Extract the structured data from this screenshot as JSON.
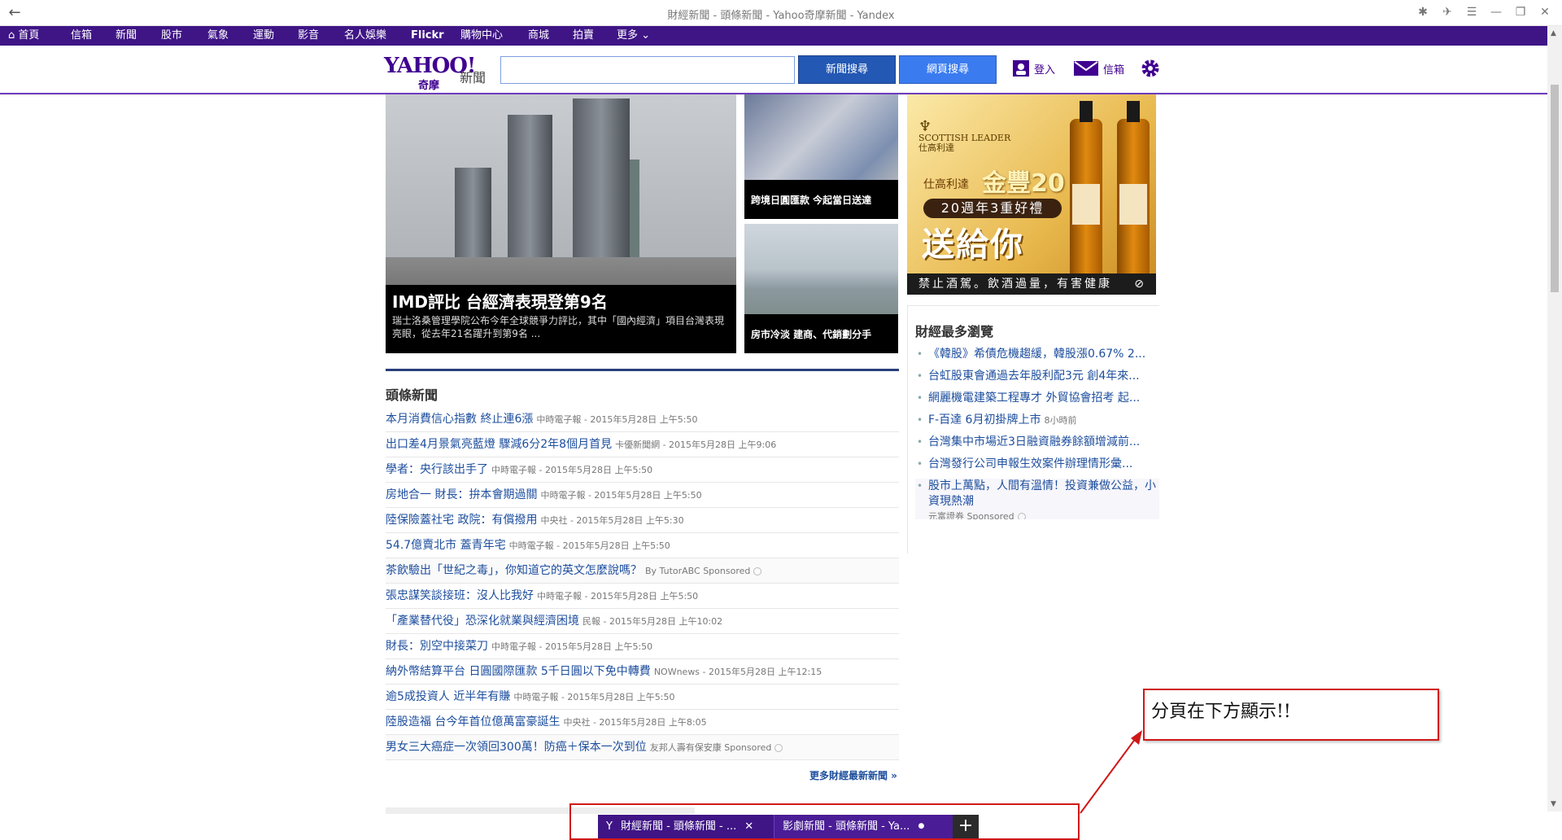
{
  "window": {
    "title": "財經新聞 - 頭條新聞 - Yahoo奇摩新聞 - Yandex",
    "back": "←"
  },
  "nav": {
    "items": [
      "首頁",
      "信箱",
      "新聞",
      "股市",
      "氣象",
      "運動",
      "影音",
      "名人娛樂",
      "Flickr",
      "購物中心",
      "商城",
      "拍賣",
      "更多"
    ]
  },
  "header": {
    "logo": "YAHOO!",
    "logo_sub": "奇摩",
    "section": "新聞",
    "search_placeholder": "",
    "news_search": "新聞搜尋",
    "web_search": "網頁搜尋",
    "login": "登入",
    "mail": "信箱"
  },
  "hero": {
    "title": "IMD評比 台經濟表現登第9名",
    "desc": "瑞士洛桑管理學院公布今年全球競爭力評比，其中「國內經濟」項目台灣表現亮眼，從去年21名躍升到第9名 ..."
  },
  "side_cards": [
    {
      "caption": "跨境日圓匯款 今起當日送達"
    },
    {
      "caption": "房市冷淡 建商、代銷劃分手"
    }
  ],
  "ad": {
    "brand": "SCOTTISH LEADER",
    "brand_cn": "仕高利達",
    "tag": "仕高利達",
    "gold": "金豐20",
    "banner": "20週年3重好禮",
    "gift": "送給你",
    "warning": "禁止酒駕。飲酒過量，有害健康"
  },
  "headlines": {
    "title": "頭條新聞",
    "items": [
      {
        "text": "本月消費信心指數 終止連6漲",
        "meta": "中時電子報 - 2015年5月28日 上午5:50",
        "sponsored": false
      },
      {
        "text": "出口差4月景氣亮藍燈 驟減6分2年8個月首見",
        "meta": "卡優新聞網 - 2015年5月28日 上午9:06",
        "sponsored": false
      },
      {
        "text": "學者：央行該出手了",
        "meta": "中時電子報 - 2015年5月28日 上午5:50",
        "sponsored": false
      },
      {
        "text": "房地合一 財長：拚本會期過關",
        "meta": "中時電子報 - 2015年5月28日 上午5:50",
        "sponsored": false
      },
      {
        "text": "陸保險蓋社宅 政院：有償撥用",
        "meta": "中央社 - 2015年5月28日 上午5:30",
        "sponsored": false
      },
      {
        "text": "54.7億賣北市 蓋青年宅",
        "meta": "中時電子報 - 2015年5月28日 上午5:50",
        "sponsored": false
      },
      {
        "text": "茶飲驗出「世紀之毒」，你知道它的英文怎麼說嗎？",
        "meta": "By TutorABC Sponsored",
        "sponsored": true
      },
      {
        "text": "張忠謀笑談接班：沒人比我好",
        "meta": "中時電子報 - 2015年5月28日 上午5:50",
        "sponsored": false
      },
      {
        "text": "「產業替代役」恐深化就業與經濟困境",
        "meta": "民報 - 2015年5月28日 上午10:02",
        "sponsored": false
      },
      {
        "text": "財長：別空中接菜刀",
        "meta": "中時電子報 - 2015年5月28日 上午5:50",
        "sponsored": false
      },
      {
        "text": "納外幣結算平台 日圓國際匯款 5千日圓以下免中轉費",
        "meta": "NOWnews - 2015年5月28日 上午12:15",
        "sponsored": false
      },
      {
        "text": "逾5成投資人 近半年有賺",
        "meta": "中時電子報 - 2015年5月28日 上午5:50",
        "sponsored": false
      },
      {
        "text": "陸股造福 台今年首位億萬富豪誕生",
        "meta": "中央社 - 2015年5月28日 上午8:05",
        "sponsored": false
      },
      {
        "text": "男女三大癌症一次領回300萬！防癌＋保本一次到位",
        "meta": "友邦人壽有保安康 Sponsored",
        "sponsored": true
      }
    ],
    "more": "更多財經最新新聞 »"
  },
  "most_viewed": {
    "title": "財經最多瀏覽",
    "items": [
      {
        "text": "《韓股》希債危機趨緩，韓股漲0.67% 2...",
        "meta": ""
      },
      {
        "text": "台虹股東會通過去年股利配3元 創4年來...",
        "meta": ""
      },
      {
        "text": "網麗機電建築工程專才 外貿協會招考 起...",
        "meta": ""
      },
      {
        "text": "F-百達 6月初掛牌上市",
        "meta": "8小時前"
      },
      {
        "text": "台灣集中市場近3日融資融券餘額增減前...",
        "meta": ""
      },
      {
        "text": "台灣發行公司申報生效案件辦理情形彙...",
        "meta": ""
      }
    ],
    "sponsored": {
      "text": "股市上萬點，人間有溫情！投資兼做公益，小資現熱潮",
      "meta": "元富證券 Sponsored"
    }
  },
  "annotation": {
    "note": "分頁在下方顯示!!"
  },
  "tabs": [
    {
      "label": "財經新聞 - 頭條新聞 - ...",
      "icon": "Y",
      "close": "✕"
    },
    {
      "label": "影劇新聞 - 頭條新聞 - Ya...",
      "dot": "●"
    }
  ],
  "new_tab": "+",
  "colors": {
    "yahoo_purple": "#3f1586",
    "link_blue": "#1d4e9e",
    "annotation_red": "#d01818"
  }
}
